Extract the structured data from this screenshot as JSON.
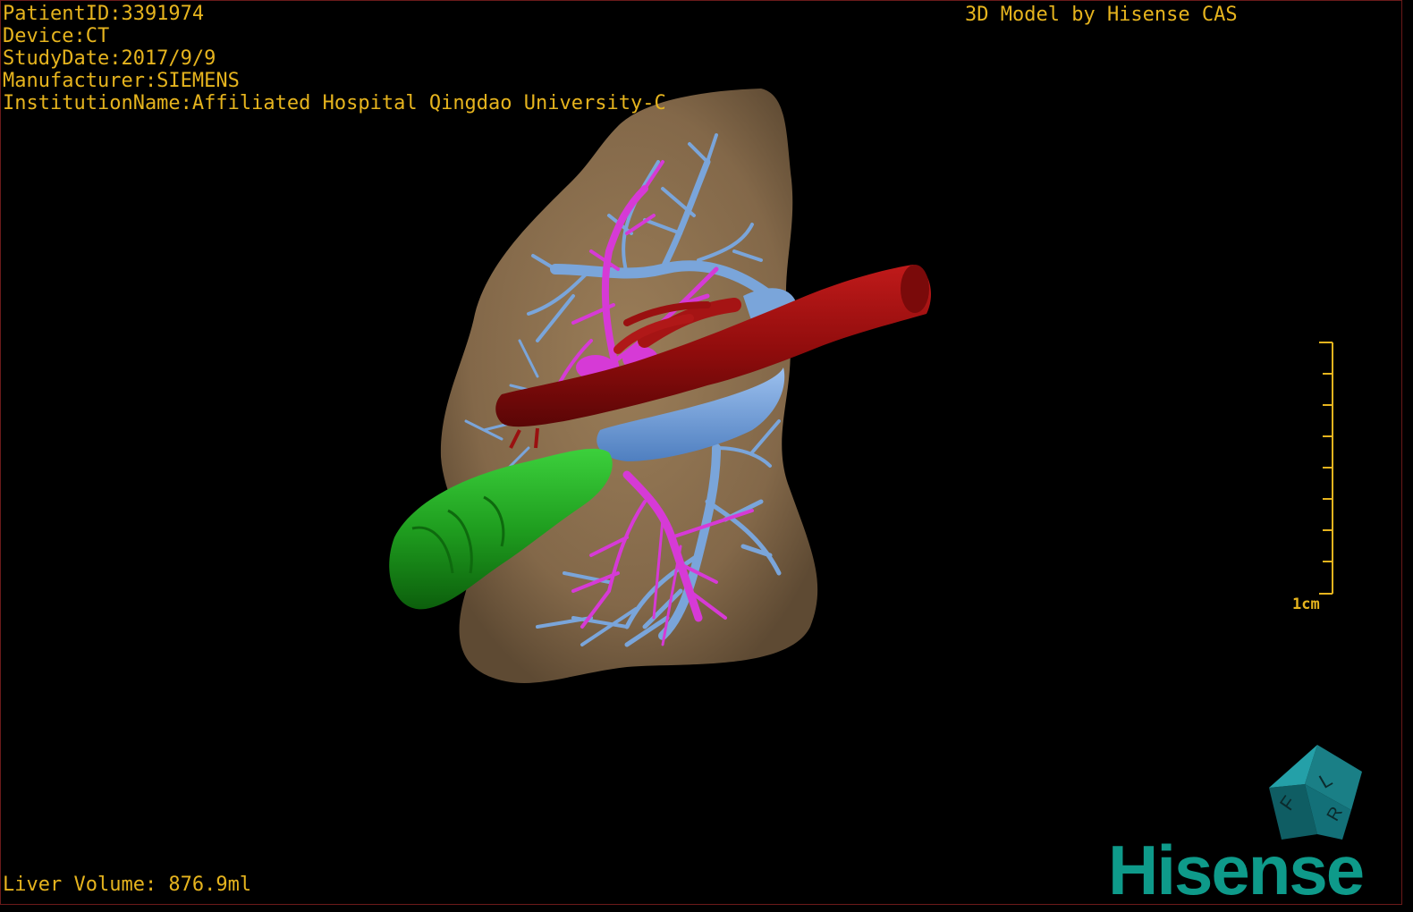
{
  "overlay": {
    "patient_id": "PatientID:3391974",
    "device": "Device:CT",
    "study_date": "StudyDate:2017/9/9",
    "manufacturer": "Manufacturer:SIEMENS",
    "institution": "InstitutionName:Affiliated Hospital Qingdao University-C",
    "credit": "3D Model by Hisense CAS",
    "liver_volume": "Liver Volume: 876.9ml"
  },
  "scale_bar": {
    "label": "1cm"
  },
  "orientation_cube": {
    "face_letters": [
      "F",
      "L",
      "R"
    ]
  },
  "brand": {
    "logo_text": "Hisense"
  },
  "colors": {
    "overlay_text": "#e6b41e",
    "liver": "#8a6f4c",
    "hepatic_vein": "#7aa5da",
    "portal_vein": "#d63ad6",
    "vena_cava": "#9a1010",
    "gallbladder": "#1f9e1f",
    "brand": "#0e9a8a"
  }
}
